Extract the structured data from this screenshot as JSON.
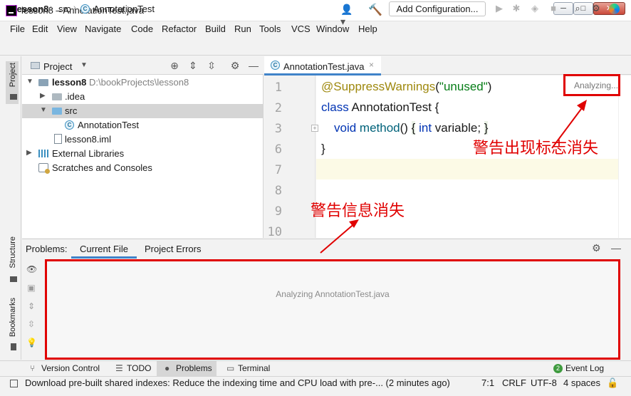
{
  "window": {
    "title": "lesson8 – AnnotationTest.java",
    "controls": [
      "─",
      "□",
      "✕"
    ]
  },
  "menu": [
    "File",
    "Edit",
    "View",
    "Navigate",
    "Code",
    "Refactor",
    "Build",
    "Run",
    "Tools",
    "VCS",
    "Window",
    "Help"
  ],
  "navbar": {
    "breadcrumbs": [
      "lesson8",
      "src",
      "AnnotationTest"
    ],
    "add_configuration": "Add Configuration..."
  },
  "left_strip": {
    "project": "Project",
    "structure": "Structure",
    "bookmarks": "Bookmarks"
  },
  "project": {
    "title": "Project",
    "tree": [
      {
        "label": "lesson8",
        "hint": "D:\\bookProjects\\lesson8",
        "icon": "module-folder-icon",
        "expanded": true
      },
      {
        "label": ".idea",
        "icon": "folder-icon",
        "expanded": false
      },
      {
        "label": "src",
        "icon": "source-folder-icon",
        "expanded": true,
        "selected": true
      },
      {
        "label": "AnnotationTest",
        "icon": "java-class-icon"
      },
      {
        "label": "lesson8.iml",
        "icon": "iml-file-icon"
      },
      {
        "label": "External Libraries",
        "icon": "libraries-icon",
        "expanded": false
      },
      {
        "label": "Scratches and Consoles",
        "icon": "scratches-icon"
      }
    ]
  },
  "editor": {
    "tab": "AnnotationTest.java",
    "analyzing": "Analyzing...",
    "line_numbers": [
      "1",
      "2",
      "3",
      "6",
      "7",
      "8",
      "9",
      "10"
    ],
    "code": {
      "l1_annotation": "@SuppressWarnings",
      "l1_open": "(",
      "l1_string": "\"unused\"",
      "l1_close": ")",
      "l2_keyword": "class",
      "l2_rest": " AnnotationTest {",
      "l3_keyword": "void",
      "l3_method": "method",
      "l3_parens": "() ",
      "l3_brace_open": "{",
      "l3_int": "int",
      "l3_body": " variable; ",
      "l3_brace_close": "}",
      "l6": "}"
    }
  },
  "annotations": {
    "warning_marker_gone": "警告出现标志消失",
    "warning_info_gone": "警告信息消失"
  },
  "problems": {
    "label": "Problems:",
    "tabs": [
      "Current File",
      "Project Errors"
    ],
    "message": "Analyzing AnnotationTest.java"
  },
  "bottom_tools": [
    "Version Control",
    "TODO",
    "Problems",
    "Terminal",
    "Event Log"
  ],
  "event_log_count": "2",
  "status": {
    "message": "Download pre-built shared indexes: Reduce the indexing time and CPU load with pre-... (2 minutes ago)",
    "position": "7:1",
    "line_ending": "CRLF",
    "encoding": "UTF-8",
    "indent": "4 spaces"
  },
  "colors": {
    "annotation_red": "#e00000",
    "accent_blue": "#4083c9"
  }
}
